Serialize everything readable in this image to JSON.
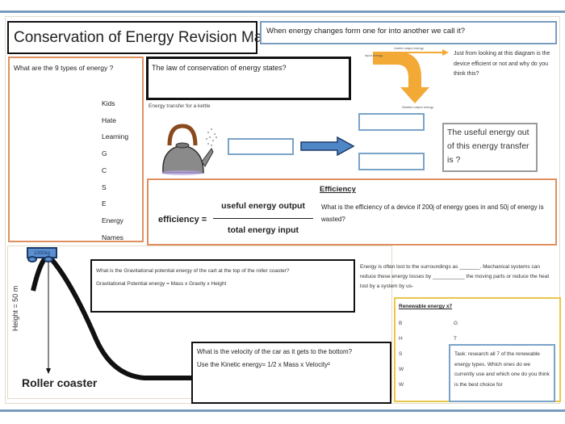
{
  "title": "Conservation of Energy Revision Mat",
  "questions": {
    "when_energy_changes": "When energy changes form one for into another we call it?",
    "nine_types": "What are the 9 types of energy ?",
    "law": "The law of conservation of energy states?",
    "diagram": "Just from looking at this diagram is the device efficient or not and why do you think this?",
    "useful_out": "The useful energy out of this energy transfer is ?"
  },
  "mnemonic": [
    "Kids",
    "Hate",
    "Learning",
    "G",
    "C",
    "S",
    "E",
    "Energy",
    "Names"
  ],
  "kettle": {
    "label": "Energy transfer for a kettle"
  },
  "sankey": {
    "input_label": "Input energy",
    "useful_label": "Useful output energy",
    "wasted_label": "Wasted output energy"
  },
  "efficiency": {
    "title": "Efficiency",
    "lhs": "efficiency =",
    "numerator": "useful energy output",
    "denominator": "total energy input",
    "question": "What is the efficiency of a device if 200j of energy goes in and 50j of energy is wasted?"
  },
  "coaster": {
    "cart_mass": "1000kg",
    "height_label": "Height = 50 m",
    "label": "Roller coaster",
    "gpe_question": "What is the Gravitational potential energy of the cart at the top of the roller coaster?",
    "gpe_formula": "Gravitational Potential energy = Mass x Gravity x Height",
    "velocity_question": "What is the velocity of the car as it gets to the bottom?",
    "kinetic_formula": "Use the Kinetic energy= 1/2 x Mass x Velocity²"
  },
  "energy_loss": "Energy is often lost to the surroundings as _______. Mechanical systems can reduce these energy losses by ___________ the moving parts or reduce the heat lost by a system by us-",
  "renewable": {
    "title": "Renewable energy  x7",
    "left": [
      "B",
      "H",
      "S",
      "W",
      "W"
    ],
    "right": [
      "G",
      "T"
    ],
    "task": "Task: research all 7 of the renewable energy types. Which ones do we currently use and which one do you think is the best choice for"
  },
  "colors": {
    "orange": "#e09060",
    "blue": "#7aa3c8",
    "yellow": "#e8c84a",
    "sankey": "#f3a935",
    "arrow": "#4f86c6"
  }
}
